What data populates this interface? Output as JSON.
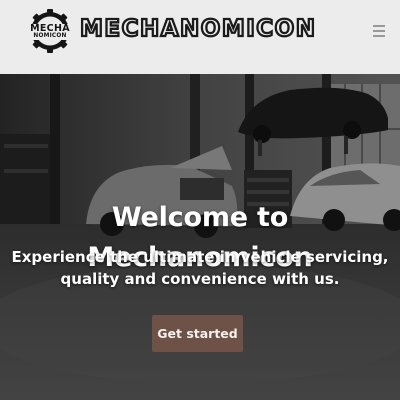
{
  "header": {
    "logo": {
      "icon": "gear-icon",
      "badge_line_1": "MECHA",
      "badge_line_2": "NOMICON"
    },
    "brand_name": "MECHANOMICON",
    "menu_icon": "hamburger-menu-icon"
  },
  "hero": {
    "background": "grayscale-garage-photo",
    "title": "Welcome to Mechanomicon",
    "subtitle": "Experience the ultimate in vehicle servicing, quality and convenience with us.",
    "cta_label": "Get started"
  },
  "colors": {
    "header_bg": "#ececec",
    "brand_text": "#1b1b1b",
    "menu_icon": "#9a9a9a",
    "hero_text": "#ffffff",
    "cta_bg": "#6e5147",
    "cta_text": "#f4f0ee"
  }
}
